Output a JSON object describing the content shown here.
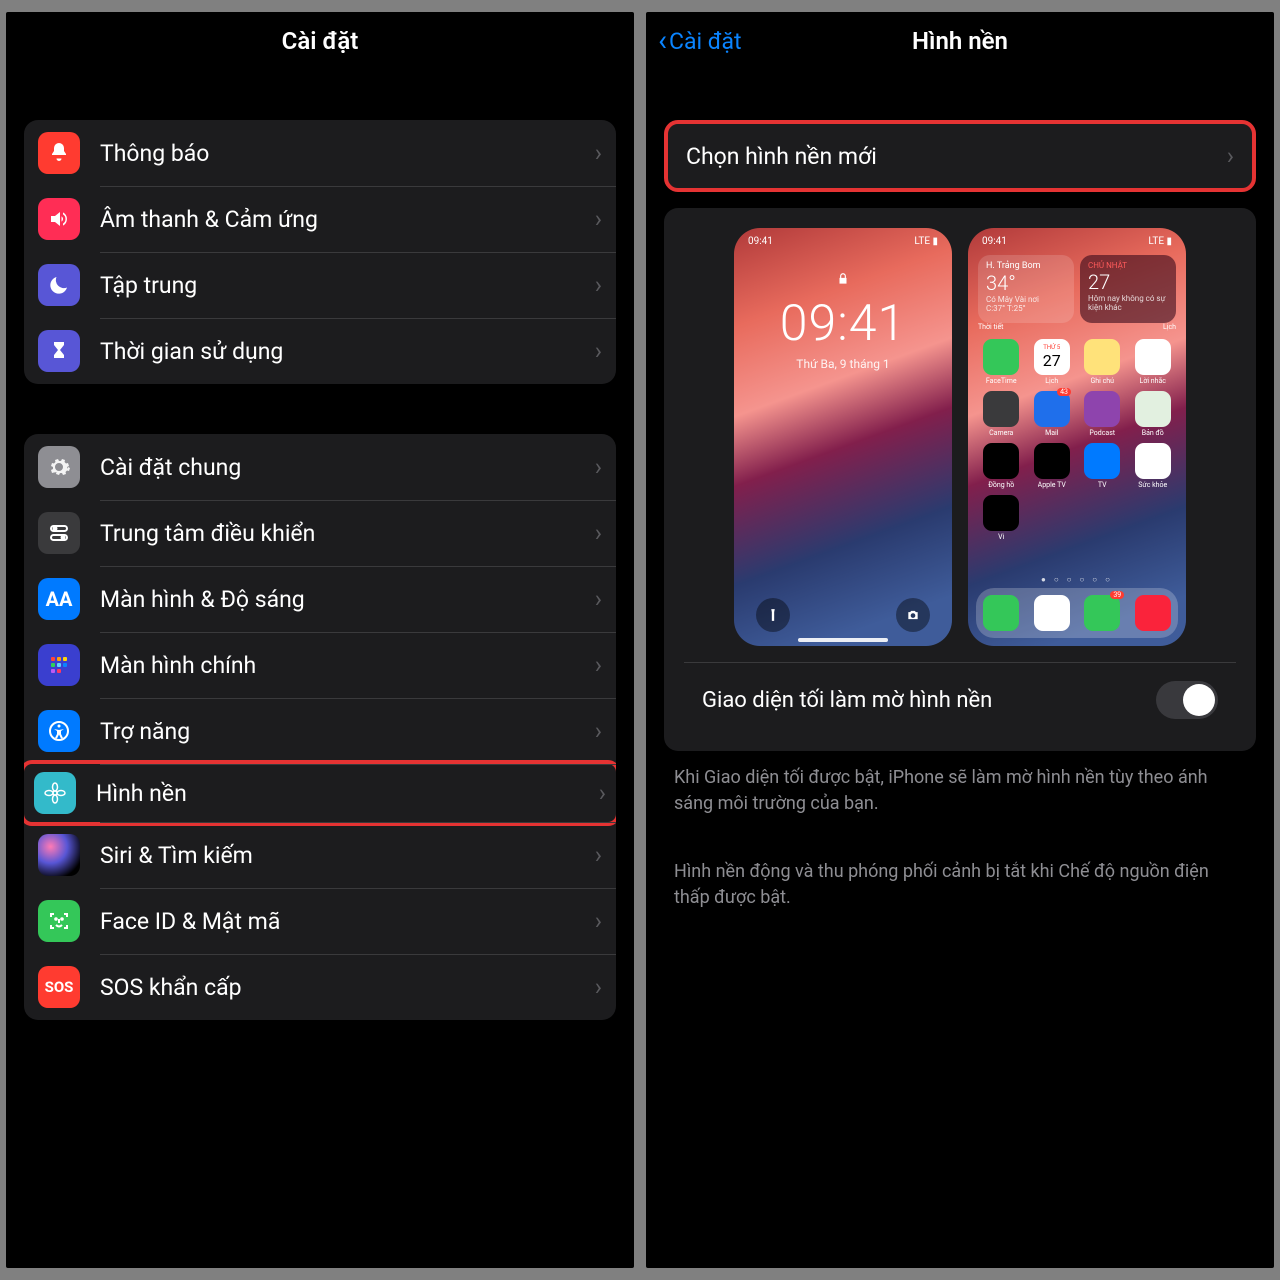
{
  "left": {
    "title": "Cài đặt",
    "group1": [
      {
        "label": "Thông báo",
        "icon": "bell",
        "color": "ic-red"
      },
      {
        "label": "Âm thanh & Cảm ứng",
        "icon": "speaker",
        "color": "ic-pink"
      },
      {
        "label": "Tập trung",
        "icon": "moon",
        "color": "ic-indigo"
      },
      {
        "label": "Thời gian sử dụng",
        "icon": "hourglass",
        "color": "ic-indigo"
      }
    ],
    "group2": [
      {
        "label": "Cài đặt chung",
        "icon": "gear",
        "color": "ic-gray"
      },
      {
        "label": "Trung tâm điều khiển",
        "icon": "switches",
        "color": "ic-darkgray"
      },
      {
        "label": "Màn hình & Độ sáng",
        "icon": "AA",
        "color": "ic-blue"
      },
      {
        "label": "Màn hình chính",
        "icon": "grid",
        "color": "ic-indigo"
      },
      {
        "label": "Trợ năng",
        "icon": "accessibility",
        "color": "ic-blue"
      },
      {
        "label": "Hình nền",
        "icon": "flower",
        "color": "ic-cyan",
        "highlight": true
      },
      {
        "label": "Siri & Tìm kiếm",
        "icon": "siri",
        "color": "ic-siri"
      },
      {
        "label": "Face ID & Mật mã",
        "icon": "faceid",
        "color": "ic-green"
      },
      {
        "label": "SOS khẩn cấp",
        "icon": "SOS",
        "color": "ic-red"
      }
    ]
  },
  "right": {
    "back": "Cài đặt",
    "title": "Hình nền",
    "choose": "Chọn hình nền mới",
    "lock": {
      "time": "09:41",
      "date": "Thứ Ba, 9 tháng 1",
      "status_time": "09:41"
    },
    "home": {
      "status_time": "09:41",
      "weather_loc": "H. Trảng Bom",
      "weather_temp": "34°",
      "weather_cond": "Có Mây Vài nơi",
      "weather_range": "C:37° T:25°",
      "weather_app": "Thời tiết",
      "cal_daylabel": "CHỦ NHẬT",
      "cal_day": "27",
      "cal_text": "Hôm nay không có sự kiện khác",
      "cal_app": "Lịch",
      "apps": [
        "FaceTime",
        "Lịch",
        "Ghi chú",
        "Lời nhắc",
        "Camera",
        "Mail",
        "Podcast",
        "Bản đồ",
        "Đồng hồ",
        "Apple TV",
        "TV",
        "Sức khỏe",
        "Ví"
      ],
      "cal_icon_day": "27",
      "cal_icon_dow": "THỨ 5",
      "mail_badge": "43",
      "msg_badge": "39"
    },
    "toggle_label": "Giao diện tối làm mờ hình nền",
    "note1": "Khi Giao diện tối được bật, iPhone sẽ làm mờ hình nền tùy theo ánh sáng môi trường của bạn.",
    "note2": "Hình nền động và thu phóng phối cảnh bị tắt khi Chế độ nguồn điện thấp được bật."
  }
}
